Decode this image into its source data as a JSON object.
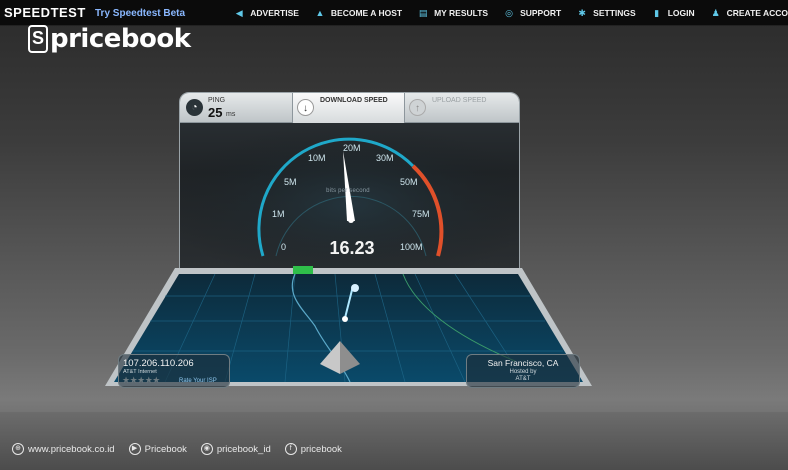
{
  "brand": {
    "name": "SPEEDTEST",
    "beta_link": "Try Speedtest Beta"
  },
  "nav": [
    {
      "label": "ADVERTISE",
      "icon": "megaphone-icon",
      "glyph": "◀"
    },
    {
      "label": "BECOME A HOST",
      "icon": "droplet-icon",
      "glyph": "▲"
    },
    {
      "label": "MY RESULTS",
      "icon": "chart-icon",
      "glyph": "▤"
    },
    {
      "label": "SUPPORT",
      "icon": "help-icon",
      "glyph": "◎"
    },
    {
      "label": "SETTINGS",
      "icon": "gear-icon",
      "glyph": "✱"
    },
    {
      "label": "LOGIN",
      "icon": "lock-icon",
      "glyph": "▮"
    },
    {
      "label": "CREATE ACCO",
      "icon": "person-icon",
      "glyph": "♟"
    }
  ],
  "watermark": {
    "mark": "S",
    "text": "pricebook"
  },
  "panel": {
    "ping": {
      "label": "PING",
      "value": "25",
      "unit": "ms"
    },
    "download": {
      "label": "DOWNLOAD SPEED"
    },
    "upload": {
      "label": "UPLOAD SPEED"
    }
  },
  "gauge": {
    "reading": "16.23",
    "unit_label": "bits per second",
    "ticks": [
      "0",
      "1M",
      "5M",
      "10M",
      "20M",
      "30M",
      "50M",
      "75M",
      "100M"
    ],
    "needle_value": "16.23",
    "colors": {
      "arc": "#1fa8c9",
      "high": "#e0502a",
      "needle": "#ffffff"
    }
  },
  "client": {
    "ip": "107.206.110.206",
    "isp": "AT&T Internet",
    "stars": "★★★★★",
    "rate_label": "Rate Your ISP"
  },
  "server": {
    "city": "San Francisco, CA",
    "hosted_by": "Hosted by",
    "host": "AT&T"
  },
  "footer": {
    "items": [
      {
        "label": "www.pricebook.co.id",
        "icon": "globe-icon",
        "glyph": "⊕"
      },
      {
        "label": "Pricebook",
        "icon": "youtube-icon",
        "glyph": "▶"
      },
      {
        "label": "pricebook_id",
        "icon": "instagram-icon",
        "glyph": "◉"
      },
      {
        "label": "pricebook",
        "icon": "facebook-icon",
        "glyph": "f"
      }
    ]
  }
}
